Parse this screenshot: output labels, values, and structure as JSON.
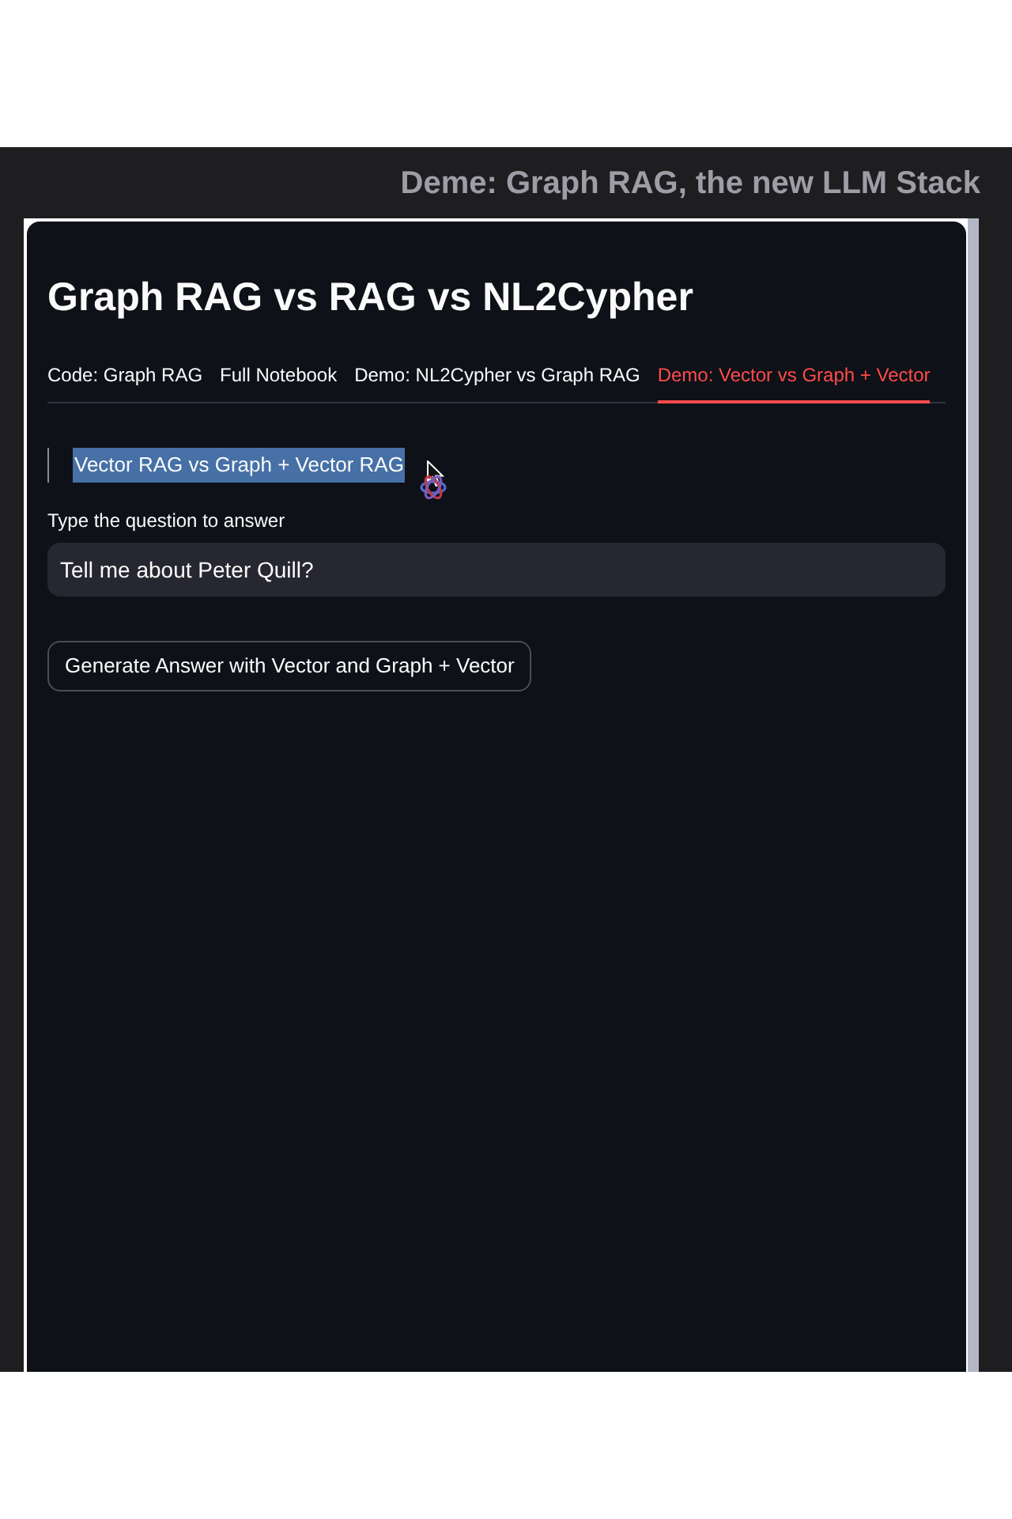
{
  "banner": {
    "title": "Deme: Graph RAG, the new LLM Stack"
  },
  "app": {
    "title": "Graph RAG vs RAG vs NL2Cypher",
    "tabs": [
      {
        "label": "Code: Graph RAG",
        "selected": false
      },
      {
        "label": "Full Notebook",
        "selected": false
      },
      {
        "label": "Demo: NL2Cypher vs Graph RAG",
        "selected": false
      },
      {
        "label": "Demo: Vector vs Graph + Vector",
        "selected": true
      }
    ],
    "section": {
      "heading": "Vector RAG vs Graph + Vector RAG",
      "highlighted": true
    },
    "question": {
      "label": "Type the question to answer",
      "value": "Tell me about Peter Quill?"
    },
    "button": {
      "label": "Generate Answer with Vector and Graph + Vector"
    }
  }
}
